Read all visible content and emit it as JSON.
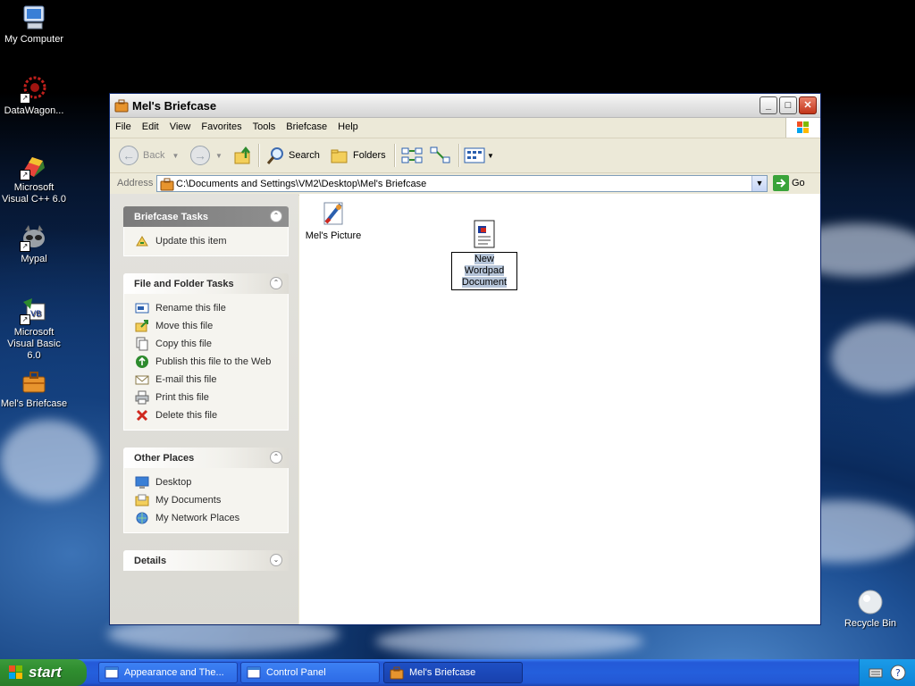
{
  "desktop": {
    "icons": [
      {
        "label": "My Computer",
        "icon": "my-computer-icon"
      },
      {
        "label": "DataWagon...",
        "icon": "datawagon-icon"
      },
      {
        "label": "Microsoft Visual C++ 6.0",
        "icon": "visual-cpp-icon"
      },
      {
        "label": "Mypal",
        "icon": "mypal-icon"
      },
      {
        "label": "Microsoft Visual Basic 6.0",
        "icon": "visual-basic-icon"
      },
      {
        "label": "Mel's Briefcase",
        "icon": "briefcase-icon"
      },
      {
        "label": "Recycle Bin",
        "icon": "recycle-bin-icon"
      }
    ]
  },
  "window": {
    "title": "Mel's Briefcase",
    "menu": [
      "File",
      "Edit",
      "View",
      "Favorites",
      "Tools",
      "Briefcase",
      "Help"
    ],
    "toolbar": {
      "back": "Back",
      "search": "Search",
      "folders": "Folders"
    },
    "address": {
      "label": "Address",
      "value": "C:\\Documents and Settings\\VM2\\Desktop\\Mel's Briefcase",
      "go": "Go"
    },
    "panels": {
      "briefcase_tasks": {
        "title": "Briefcase Tasks",
        "items": [
          "Update this item"
        ]
      },
      "file_folder_tasks": {
        "title": "File and Folder Tasks",
        "items": [
          "Rename this file",
          "Move this file",
          "Copy this file",
          "Publish this file to the Web",
          "E-mail this file",
          "Print this file",
          "Delete this file"
        ]
      },
      "other_places": {
        "title": "Other Places",
        "items": [
          "Desktop",
          "My Documents",
          "My Network Places"
        ]
      },
      "details": {
        "title": "Details"
      }
    },
    "files": [
      {
        "label": "Mel's Picture",
        "icon": "paint-picture-icon"
      },
      {
        "label": "New Wordpad Document",
        "icon": "wordpad-document-icon",
        "selected": true
      }
    ]
  },
  "taskbar": {
    "start": "start",
    "tasks": [
      {
        "label": "Appearance and The...",
        "icon": "control-panel-window-icon"
      },
      {
        "label": "Control Panel",
        "icon": "control-panel-window-icon"
      },
      {
        "label": "Mel's Briefcase",
        "icon": "briefcase-icon",
        "active": true
      }
    ]
  }
}
